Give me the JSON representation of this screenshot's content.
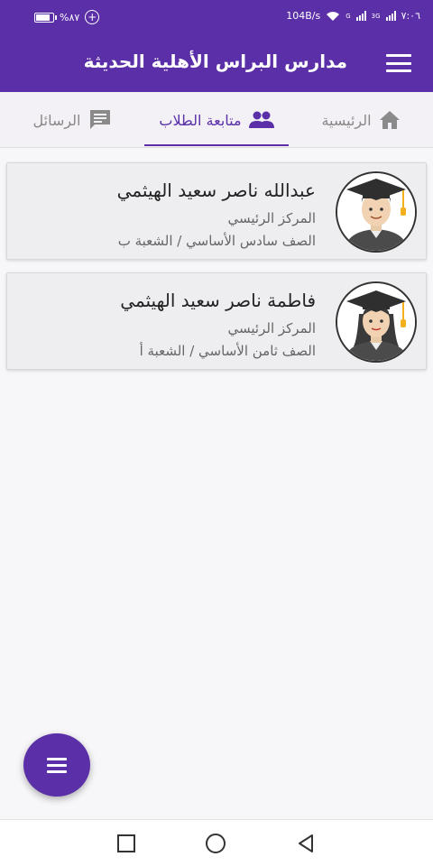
{
  "status_bar": {
    "time": "٧:٠٦",
    "net_speed": "104B/s",
    "battery_percent": "%٨٧",
    "battery_level": 0.87,
    "signal_label_3g": "3G",
    "signal_label_g": "G"
  },
  "app_bar": {
    "title": "مدارس البراس الأهلية الحديثة",
    "menu_icon": "hamburger-menu-icon"
  },
  "tabs": [
    {
      "label": "الرئيسية",
      "icon": "home-icon",
      "active": false
    },
    {
      "label": "متابعة الطلاب",
      "icon": "people-icon",
      "active": true
    },
    {
      "label": "الرسائل",
      "icon": "message-icon",
      "active": false
    }
  ],
  "students": [
    {
      "name": "عبدالله ناصر سعيد الهيثمي",
      "branch": "المركز الرئيسي",
      "grade": "الصف سادس الأساسي / الشعبة ب",
      "avatar": "male-graduate-icon"
    },
    {
      "name": "فاطمة ناصر سعيد الهيثمي",
      "branch": "المركز الرئيسي",
      "grade": "الصف ثامن الأساسي / الشعبة أ",
      "avatar": "female-graduate-icon"
    }
  ],
  "fab_icon": "menu-icon",
  "colors": {
    "primary": "#5a2fa8",
    "tab_inactive": "#888888",
    "card_bg": "#eeedf0"
  }
}
